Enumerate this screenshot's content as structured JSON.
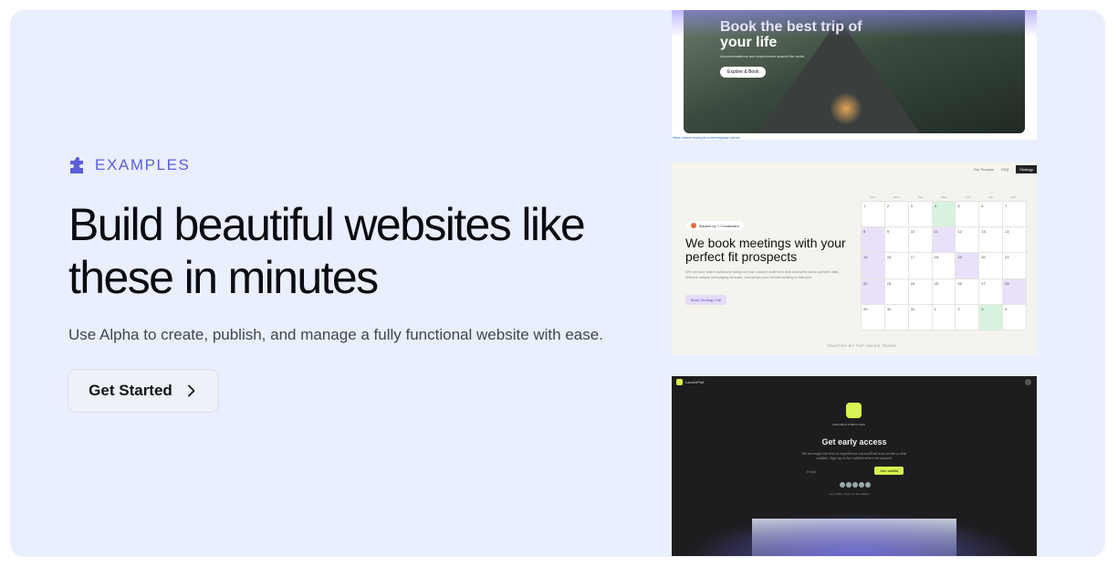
{
  "eyebrow": {
    "label": "EXAMPLES"
  },
  "headline": "Build beautiful websites like these in minutes",
  "subtitle": "Use Alpha to create, publish, and manage a fully functional website with ease.",
  "cta": {
    "label": "Get Started"
  },
  "colors": {
    "panel_bg": "#e9effd",
    "accent": "#5b5fd9",
    "text": "#0b0b12"
  },
  "examples": {
    "travel": {
      "title": "Book the best trip of your life",
      "tagline": "Accommodations and experiences around the world",
      "button": "Explore & Book",
      "caption": "https://www.example.com/unsplash-photo"
    },
    "meetings": {
      "nav": [
        "Our Process",
        "FAQ",
        "Strategy"
      ],
      "badge": "Backed by Y Combinator",
      "title": "We book meetings with your perfect fit prospects",
      "body": "We run your entire outbound using our own custom-built tech that uncovers niche-specific data, delivers unique messaging at scale, and keeps your emails landing in inboxes.",
      "button": "Book Strategy Call",
      "footer": "TRUSTED BY TOP SALES TEAMS",
      "weekdays": [
        "SUN",
        "MON",
        "TUE",
        "WED",
        "THU",
        "FRI",
        "SAT"
      ],
      "calendar": [
        "1",
        "2",
        "3",
        "4",
        "5",
        "6",
        "7",
        "8",
        "9",
        "10",
        "11",
        "12",
        "13",
        "14",
        "15",
        "16",
        "17",
        "18",
        "19",
        "20",
        "21",
        "22",
        "23",
        "24",
        "25",
        "26",
        "27",
        "28",
        "29",
        "30",
        "31",
        "1",
        "2",
        "3",
        "4"
      ]
    },
    "launchpad": {
      "brand": "LaunchPad",
      "pill": "AVAILABLE IN BETA NOW",
      "title": "Get early access",
      "body": "Be amongst the first to experience LaunchPad and create a viral waitlist. Sign up to be notified when we launch!",
      "email_placeholder": "Email",
      "button": "Join waitlist",
      "joined": "Join 2,000+ others on the waitlist"
    }
  }
}
